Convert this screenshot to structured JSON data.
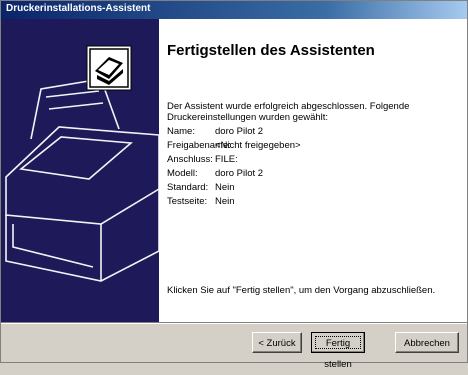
{
  "window": {
    "title": "Druckerinstallations-Assistent"
  },
  "main": {
    "heading": "Fertigstellen des Assistenten",
    "intro": "Der Assistent wurde erfolgreich abgeschlossen. Folgende Druckereinstellungen wurden gewählt:",
    "settings": [
      {
        "key": "Name:",
        "value": "doro Pilot 2"
      },
      {
        "key": "Freigabename:",
        "value": "<Nicht freigegeben>"
      },
      {
        "key": "Anschluss:",
        "value": "FILE:"
      },
      {
        "key": "Modell:",
        "value": "doro Pilot 2"
      },
      {
        "key": "Standard:",
        "value": "Nein"
      },
      {
        "key": "Testseite:",
        "value": "Nein"
      }
    ],
    "footer_text": "Klicken Sie auf \"Fertig stellen\", um den Vorgang abzuschließen."
  },
  "buttons": {
    "back": "< Zurück",
    "finish": "Fertig stellen",
    "cancel": "Abbrechen"
  },
  "icons": {
    "wizard": "printer-wizard-icon"
  },
  "colors": {
    "side_panel": "#1e1a5a",
    "titlebar_start": "#0a246a",
    "titlebar_end": "#a6caf0"
  }
}
